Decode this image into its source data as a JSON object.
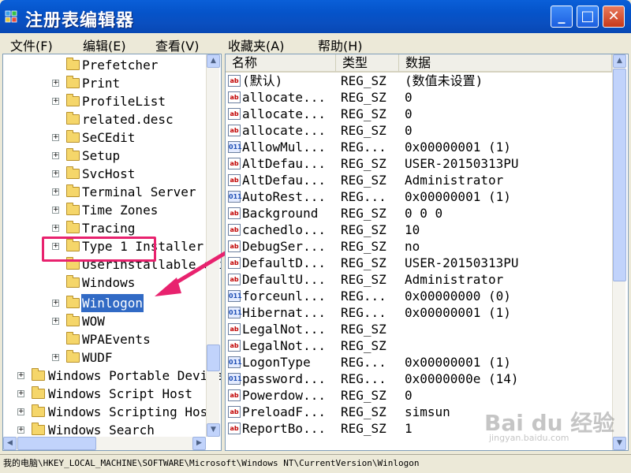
{
  "window": {
    "title": "注册表编辑器",
    "minimize": "_",
    "maximize": "□",
    "close": "✕"
  },
  "menu": [
    "文件(F)",
    "编辑(E)",
    "查看(V)",
    "收藏夹(A)",
    "帮助(H)"
  ],
  "tree": {
    "items": [
      {
        "label": "Prefetcher",
        "expander": ""
      },
      {
        "label": "Print",
        "expander": "+"
      },
      {
        "label": "ProfileList",
        "expander": "+"
      },
      {
        "label": "related.desc",
        "expander": ""
      },
      {
        "label": "SeCEdit",
        "expander": "+"
      },
      {
        "label": "Setup",
        "expander": "+"
      },
      {
        "label": "SvcHost",
        "expander": "+"
      },
      {
        "label": "Terminal Server",
        "expander": "+"
      },
      {
        "label": "Time Zones",
        "expander": "+"
      },
      {
        "label": "Tracing",
        "expander": "+"
      },
      {
        "label": "Type 1 Installer",
        "expander": "+"
      },
      {
        "label": "Userinstallable.drivers",
        "expander": ""
      },
      {
        "label": "Windows",
        "expander": ""
      },
      {
        "label": "Winlogon",
        "expander": "+",
        "selected": true
      },
      {
        "label": "WOW",
        "expander": "+"
      },
      {
        "label": "WPAEvents",
        "expander": ""
      },
      {
        "label": "WUDF",
        "expander": "+"
      },
      {
        "label": "Windows Portable Devices",
        "expander": "+",
        "level": 1
      },
      {
        "label": "Windows Script Host",
        "expander": "+",
        "level": 1
      },
      {
        "label": "Windows Scripting Host",
        "expander": "+",
        "level": 1
      },
      {
        "label": "Windows Search",
        "expander": "+",
        "level": 1
      }
    ]
  },
  "values": {
    "headers": {
      "name": "名称",
      "type": "类型",
      "data": "数据"
    },
    "rows": [
      {
        "icon": "ab",
        "name": "(默认)",
        "type": "REG_SZ",
        "data": "(数值未设置)"
      },
      {
        "icon": "ab",
        "name": "allocate...",
        "type": "REG_SZ",
        "data": "0"
      },
      {
        "icon": "ab",
        "name": "allocate...",
        "type": "REG_SZ",
        "data": "0"
      },
      {
        "icon": "ab",
        "name": "allocate...",
        "type": "REG_SZ",
        "data": "0"
      },
      {
        "icon": "011",
        "name": "AllowMul...",
        "type": "REG...",
        "data": "0x00000001 (1)"
      },
      {
        "icon": "ab",
        "name": "AltDefau...",
        "type": "REG_SZ",
        "data": "USER-20150313PU"
      },
      {
        "icon": "ab",
        "name": "AltDefau...",
        "type": "REG_SZ",
        "data": "Administrator"
      },
      {
        "icon": "011",
        "name": "AutoRest...",
        "type": "REG...",
        "data": "0x00000001 (1)"
      },
      {
        "icon": "ab",
        "name": "Background",
        "type": "REG_SZ",
        "data": "0 0 0"
      },
      {
        "icon": "ab",
        "name": "cachedlo...",
        "type": "REG_SZ",
        "data": "10"
      },
      {
        "icon": "ab",
        "name": "DebugSer...",
        "type": "REG_SZ",
        "data": "no"
      },
      {
        "icon": "ab",
        "name": "DefaultD...",
        "type": "REG_SZ",
        "data": "USER-20150313PU"
      },
      {
        "icon": "ab",
        "name": "DefaultU...",
        "type": "REG_SZ",
        "data": "Administrator"
      },
      {
        "icon": "011",
        "name": "forceunl...",
        "type": "REG...",
        "data": "0x00000000 (0)"
      },
      {
        "icon": "011",
        "name": "Hibernat...",
        "type": "REG...",
        "data": "0x00000001 (1)"
      },
      {
        "icon": "ab",
        "name": "LegalNot...",
        "type": "REG_SZ",
        "data": ""
      },
      {
        "icon": "ab",
        "name": "LegalNot...",
        "type": "REG_SZ",
        "data": ""
      },
      {
        "icon": "011",
        "name": "LogonType",
        "type": "REG...",
        "data": "0x00000001 (1)"
      },
      {
        "icon": "011",
        "name": "password...",
        "type": "REG...",
        "data": "0x0000000e (14)"
      },
      {
        "icon": "ab",
        "name": "Powerdow...",
        "type": "REG_SZ",
        "data": "0"
      },
      {
        "icon": "ab",
        "name": "PreloadF...",
        "type": "REG_SZ",
        "data": "simsun"
      },
      {
        "icon": "ab",
        "name": "ReportBo...",
        "type": "REG_SZ",
        "data": "1"
      }
    ]
  },
  "status": {
    "path": "我的电脑\\HKEY_LOCAL_MACHINE\\SOFTWARE\\Microsoft\\Windows NT\\CurrentVersion\\Winlogon"
  },
  "watermark": {
    "logo": "Bai du 经验",
    "site": "jingyan.baidu.com"
  },
  "colors": {
    "title_bar": "#0553c9",
    "selection": "#316ac5",
    "highlight_box": "#e8226e"
  }
}
